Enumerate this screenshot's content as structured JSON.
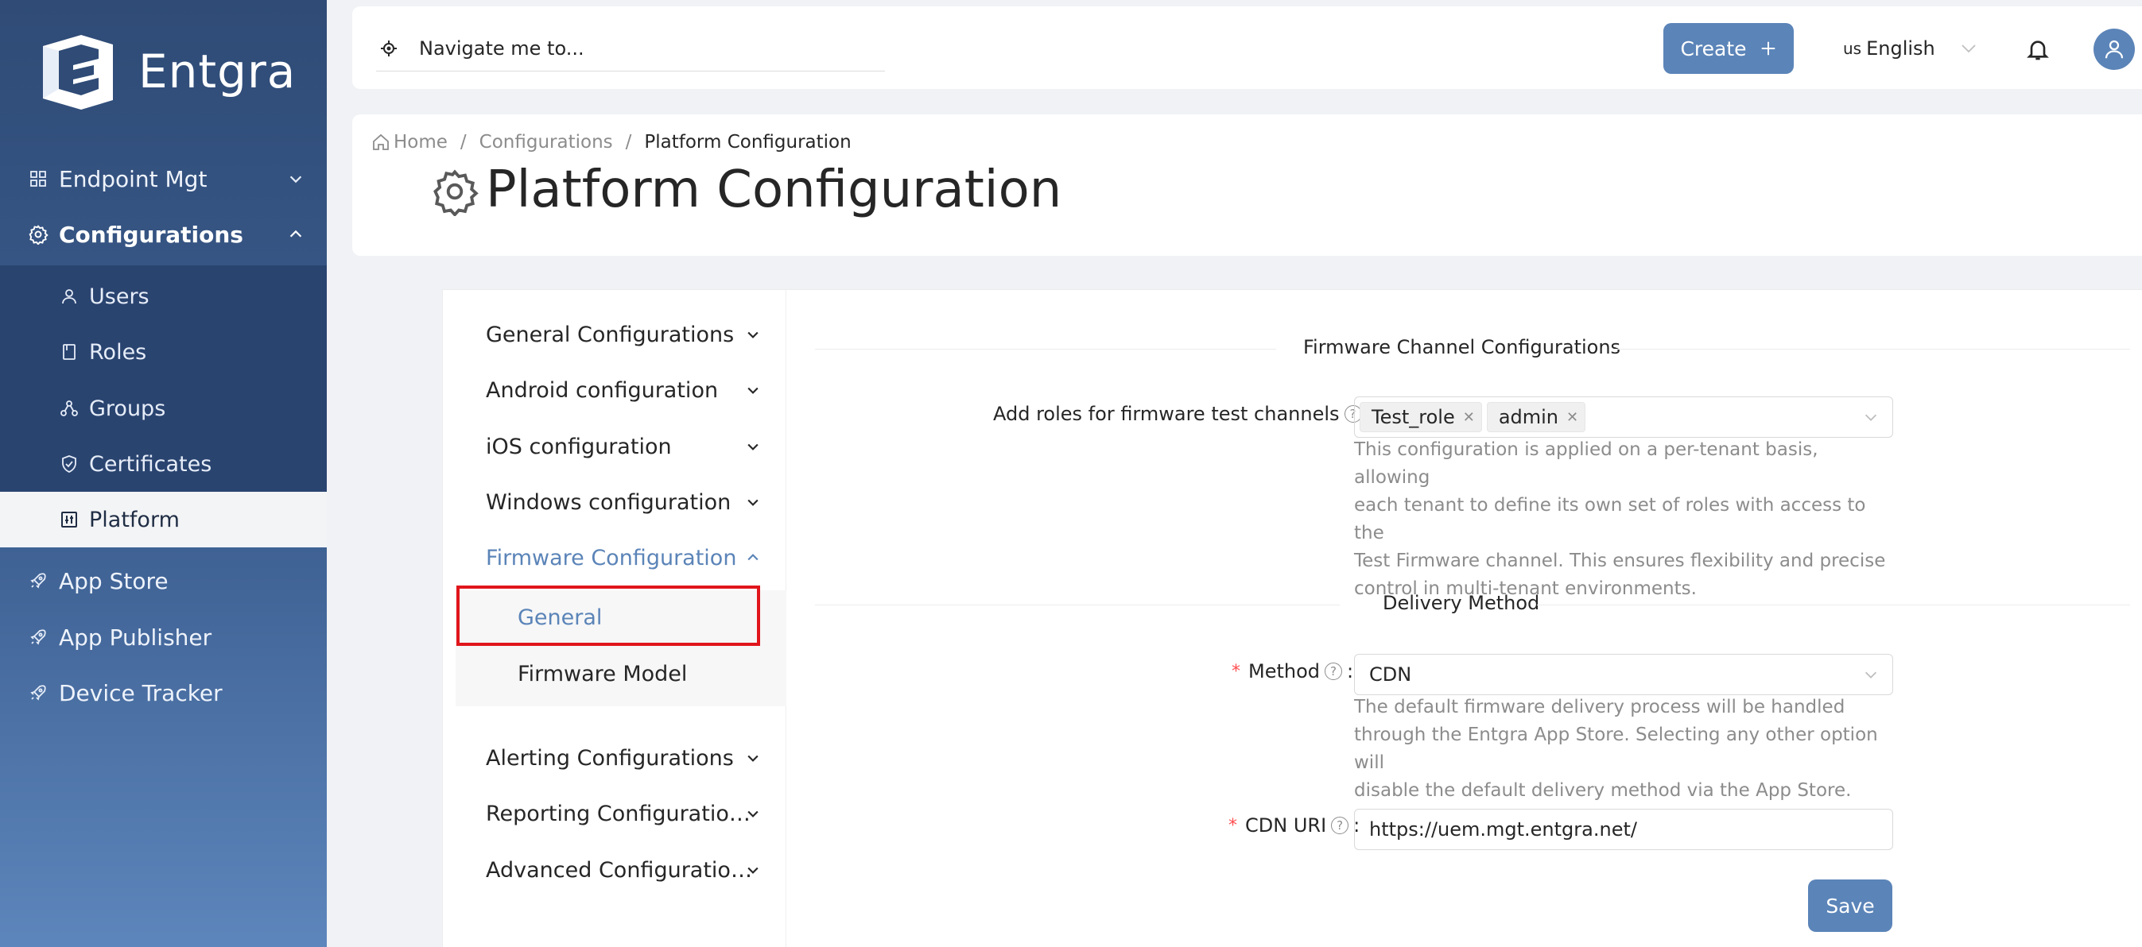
{
  "brand": {
    "name": "Entgra"
  },
  "sidebar": {
    "items": [
      {
        "label": "Endpoint Mgt"
      },
      {
        "label": "Configurations"
      },
      {
        "label": "App Store"
      },
      {
        "label": "App Publisher"
      },
      {
        "label": "Device Tracker"
      }
    ],
    "sub_items": [
      {
        "label": "Users"
      },
      {
        "label": "Roles"
      },
      {
        "label": "Groups"
      },
      {
        "label": "Certificates"
      },
      {
        "label": "Platform"
      }
    ]
  },
  "header": {
    "search_placeholder": "Navigate me to...",
    "create_label": "Create",
    "lang_code": "us",
    "lang_label": "English"
  },
  "breadcrumb": [
    "Home",
    "Configurations",
    "Platform Configuration"
  ],
  "page_title": "Platform Configuration",
  "menu": {
    "items": [
      "General Configurations",
      "Android configuration",
      "iOS configuration",
      "Windows configuration",
      "Firmware Configuration",
      "Alerting Configurations",
      "Reporting Configuratio…",
      "Advanced Configuratio…"
    ],
    "firmware_sub": [
      "General",
      "Firmware Model"
    ]
  },
  "form": {
    "section1_title": "Firmware Channel Configurations",
    "roles_label": "Add roles for firmware test channels",
    "roles_tags": [
      "Test_role",
      "admin"
    ],
    "roles_help": [
      "This configuration is applied on a per-tenant basis, allowing",
      "each tenant to define its own set of roles with access to the",
      "Test Firmware channel. This ensures flexibility and precise",
      "control in multi-tenant environments."
    ],
    "section2_title": "Delivery Method",
    "method_label": "Method",
    "method_value": "CDN",
    "method_help": [
      "The default firmware delivery process will be handled",
      "through the Entgra App Store. Selecting any other option will",
      "disable the default delivery method via the App Store."
    ],
    "cdn_label": "CDN URI",
    "cdn_value": "https://uem.mgt.entgra.net/",
    "save_label": "Save"
  }
}
